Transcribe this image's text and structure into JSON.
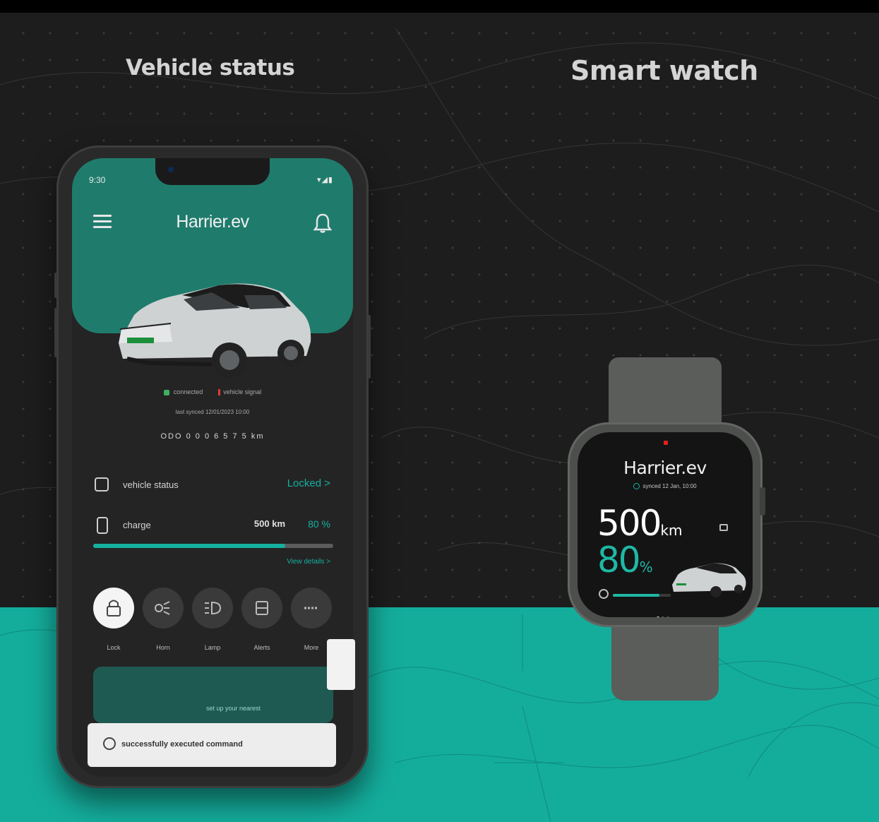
{
  "headings": {
    "vehicle_status": "Vehicle status",
    "smart_watch": "Smart watch"
  },
  "colors": {
    "teal": "#14ad9c",
    "header_teal": "#1f7c6c",
    "background": "#1d1d1d",
    "accent": "#15b0a0",
    "alert_red": "#e03a3a"
  },
  "phone": {
    "status_time": "9:30",
    "status_icons": "▾◢▮",
    "app_title": "Harrier.ev",
    "menu_icon": "menu-icon",
    "bell_icon": "bell-icon",
    "connection": {
      "connected": "connected",
      "signal": "vehicle signal",
      "last_synced": "last synced 12/01/2023 10:00"
    },
    "odometer": "ODO  0 0 0 6 5 7 5  km",
    "vehicle_status": {
      "label": "vehicle status",
      "value": "Locked >"
    },
    "charge": {
      "label": "charge",
      "range": "500 km",
      "percent": "80 %",
      "level": 0.8,
      "details_link": "View details >"
    },
    "actions": [
      {
        "label": "Lock",
        "icon": "lock-icon",
        "active": true
      },
      {
        "label": "Horn",
        "icon": "horn-icon",
        "active": false
      },
      {
        "label": "Lamp",
        "icon": "lamp-icon",
        "active": false
      },
      {
        "label": "Alerts",
        "icon": "alert-icon",
        "active": false
      },
      {
        "label": "More",
        "icon": "more-icon",
        "active": false
      }
    ],
    "lower_card_text": "set up your nearest",
    "toast": "successfully executed command"
  },
  "watch": {
    "title": "Harrier.ev",
    "synced": "synced 12 Jan, 10:00",
    "range_value": "500",
    "range_unit": "km",
    "percent_value": "80",
    "percent_unit": "%",
    "charge_level": 0.8,
    "page_count": 3,
    "active_page": 1
  }
}
